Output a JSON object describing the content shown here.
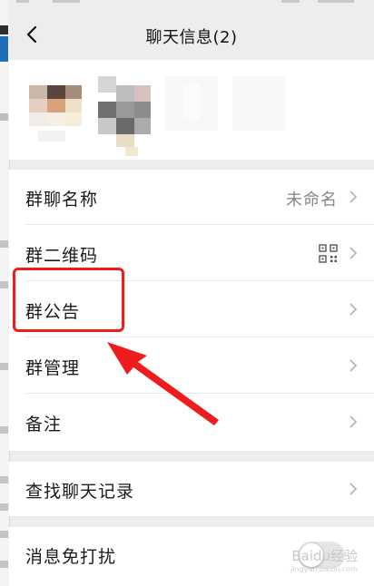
{
  "nav": {
    "title": "聊天信息(2)"
  },
  "settings": {
    "group_name_label": "群聊名称",
    "group_name_value": "未命名",
    "qr_label": "群二维码",
    "announcement_label": "群公告",
    "manage_label": "群管理",
    "remark_label": "备注",
    "search_history_label": "查找聊天记录",
    "mute_label": "消息免打扰",
    "mute_enabled": false
  },
  "watermark": {
    "text": "Baidu经验",
    "url": "jingyan.baidu.com"
  },
  "colors": {
    "highlight": "#ee1c1c",
    "background": "#ededed",
    "card": "#ffffff"
  }
}
